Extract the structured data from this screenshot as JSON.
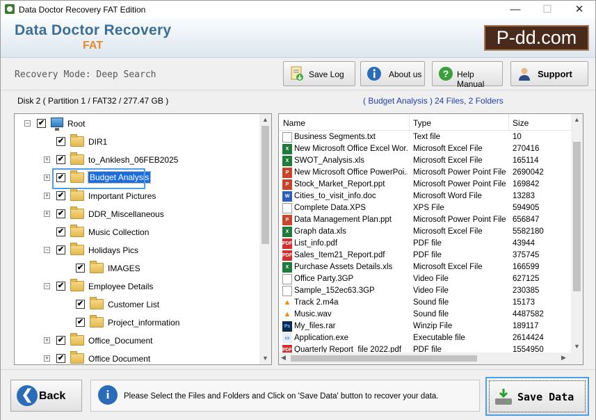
{
  "window": {
    "title": "Data Doctor Recovery FAT Edition",
    "minimize": "—",
    "maximize": "☐",
    "close": "✕"
  },
  "header": {
    "brand": "Data Doctor Recovery",
    "edition": "FAT",
    "logo": "P-dd.com"
  },
  "toolbar": {
    "mode": "Recovery Mode: Deep Search",
    "save_log": "Save Log",
    "about_us": "About us",
    "help_manual": "Help Manual",
    "support": "Support"
  },
  "left_pane": {
    "header": "Disk 2 ( Partition 1 / FAT32 / 277.47 GB )",
    "nodes": [
      {
        "label": "Root",
        "depth": 0,
        "expander": "−",
        "icon": "monitor-icon"
      },
      {
        "label": "DIR1",
        "depth": 1,
        "expander": "",
        "icon": "folder-icon"
      },
      {
        "label": "to_Anklesh_06FEB2025",
        "depth": 1,
        "expander": "+",
        "icon": "folder-icon"
      },
      {
        "label": "Budget Analysis",
        "depth": 1,
        "expander": "+",
        "icon": "folder-open-icon",
        "selected": true
      },
      {
        "label": "Important Pictures",
        "depth": 1,
        "expander": "+",
        "icon": "folder-icon"
      },
      {
        "label": "DDR_Miscellaneous",
        "depth": 1,
        "expander": "+",
        "icon": "folder-icon"
      },
      {
        "label": "Music Collection",
        "depth": 1,
        "expander": "",
        "icon": "folder-icon"
      },
      {
        "label": "Holidays Pics",
        "depth": 1,
        "expander": "−",
        "icon": "folder-icon"
      },
      {
        "label": "IMAGES",
        "depth": 2,
        "expander": "",
        "icon": "folder-icon"
      },
      {
        "label": "Employee Details",
        "depth": 1,
        "expander": "−",
        "icon": "folder-icon"
      },
      {
        "label": "Customer List",
        "depth": 2,
        "expander": "",
        "icon": "folder-icon"
      },
      {
        "label": "Project_information",
        "depth": 2,
        "expander": "",
        "icon": "folder-icon"
      },
      {
        "label": "Office_Document",
        "depth": 1,
        "expander": "+",
        "icon": "folder-icon"
      },
      {
        "label": "Office Document",
        "depth": 1,
        "expander": "+",
        "icon": "folder-icon"
      }
    ]
  },
  "right_pane": {
    "folder": "( Budget Analysis )",
    "counts": "24 Files, 2 Folders",
    "columns": [
      "Name",
      "Type",
      "Size"
    ],
    "rows": [
      {
        "name": "Business Segments.txt",
        "type": "Text file",
        "size": "10",
        "icon": "txt"
      },
      {
        "name": "New Microsoft Office Excel Wor...",
        "type": "Microsoft Excel File",
        "size": "270416",
        "icon": "xls"
      },
      {
        "name": "SWOT_Analysis.xls",
        "type": "Microsoft Excel File",
        "size": "165114",
        "icon": "xls"
      },
      {
        "name": "New Microsoft Office PowerPoi...",
        "type": "Microsoft Power Point File",
        "size": "2690042",
        "icon": "ppt"
      },
      {
        "name": "Stock_Market_Report.ppt",
        "type": "Microsoft Power Point File",
        "size": "169842",
        "icon": "ppt"
      },
      {
        "name": "Cities_to_visit_info.doc",
        "type": "Microsoft Word File",
        "size": "13283",
        "icon": "doc"
      },
      {
        "name": "Complete Data.XPS",
        "type": "XPS File",
        "size": "594905",
        "icon": "txt"
      },
      {
        "name": "Data Management Plan.ppt",
        "type": "Microsoft Power Point File",
        "size": "656847",
        "icon": "ppt"
      },
      {
        "name": "Graph data.xls",
        "type": "Microsoft Excel File",
        "size": "5582180",
        "icon": "xls"
      },
      {
        "name": "List_info.pdf",
        "type": "PDF file",
        "size": "43944",
        "icon": "pdf"
      },
      {
        "name": "Sales_Item21_Report.pdf",
        "type": "PDF file",
        "size": "375745",
        "icon": "pdf"
      },
      {
        "name": "Purchase Assets Details.xls",
        "type": "Microsoft Excel File",
        "size": "166599",
        "icon": "xls"
      },
      {
        "name": "Office Party.3GP",
        "type": "Video File",
        "size": "627125",
        "icon": "txt"
      },
      {
        "name": "Sample_152ec63.3GP",
        "type": "Video File",
        "size": "230385",
        "icon": "txt"
      },
      {
        "name": "Track 2.m4a",
        "type": "Sound file",
        "size": "15173",
        "icon": "cone"
      },
      {
        "name": "Music.wav",
        "type": "Sound file",
        "size": "4487582",
        "icon": "cone"
      },
      {
        "name": "My_files.rar",
        "type": "Winzip File",
        "size": "189117",
        "icon": "ps"
      },
      {
        "name": "Application.exe",
        "type": "Executable file",
        "size": "2614424",
        "icon": "exe"
      },
      {
        "name": "Quarterly Report_file 2022.pdf",
        "type": "PDF file",
        "size": "1554950",
        "icon": "pdf"
      }
    ]
  },
  "bottom": {
    "back": "Back",
    "info": "Please Select the Files and Folders and Click on 'Save Data' button to recover your data.",
    "save": "Save Data"
  },
  "colors": {
    "accent": "#1c6ee0",
    "brand": "#3c6e96",
    "edition": "#e08b2a",
    "link": "#1f3fa8"
  }
}
